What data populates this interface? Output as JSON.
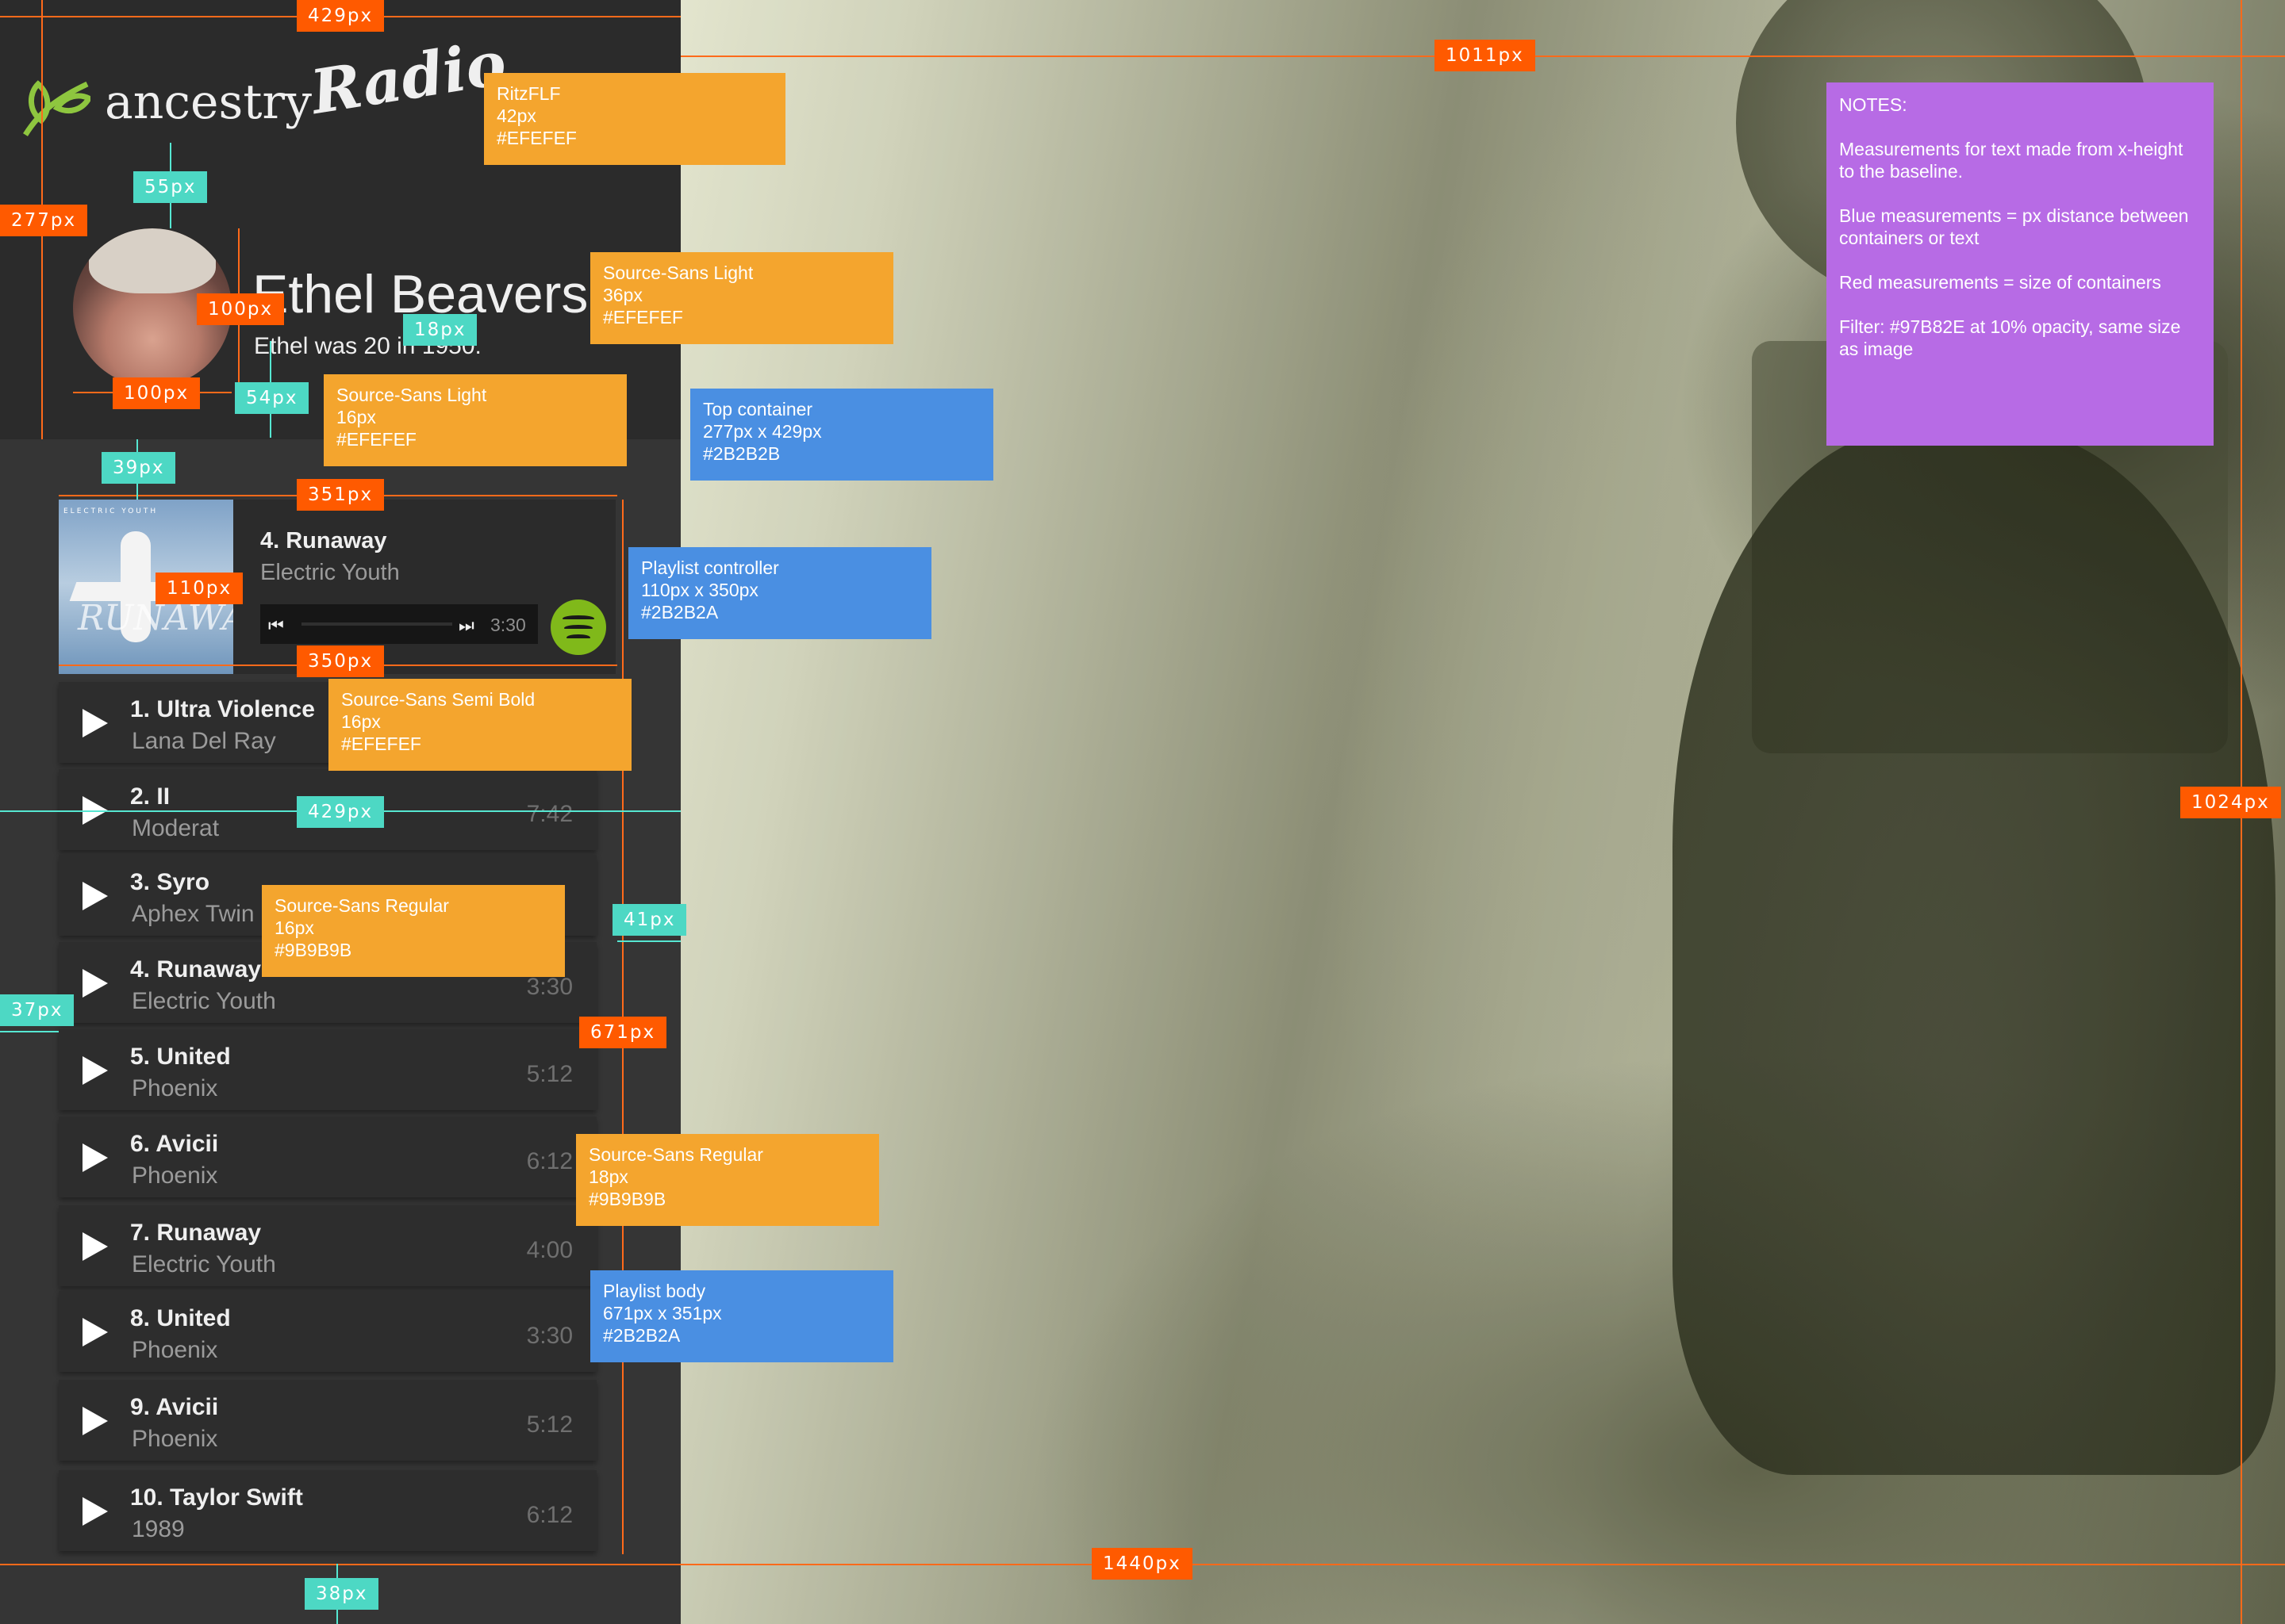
{
  "app": {
    "logo_text": "ancestry",
    "logo_radio": "Radio"
  },
  "profile": {
    "name": "Ethel Beavers",
    "subtitle": "Ethel was 20 in 1950."
  },
  "now_playing": {
    "title": "4. Runaway",
    "artist": "Electric Youth",
    "time": "3:30",
    "album_brand": "ELECTRIC YOUTH",
    "album_word": "RUNAWAY",
    "service": "spotify-icon"
  },
  "playlist": [
    {
      "title": "1. Ultra Violence",
      "artist": "Lana Del Ray",
      "duration": ""
    },
    {
      "title": "2. II",
      "artist": "Moderat",
      "duration": "7:42"
    },
    {
      "title": "3. Syro",
      "artist": "Aphex Twin",
      "duration": ""
    },
    {
      "title": "4. Runaway",
      "artist": "Electric Youth",
      "duration": "3:30"
    },
    {
      "title": "5. United",
      "artist": "Phoenix",
      "duration": "5:12"
    },
    {
      "title": "6. Avicii",
      "artist": "Phoenix",
      "duration": "6:12"
    },
    {
      "title": "7. Runaway",
      "artist": "Electric Youth",
      "duration": "4:00"
    },
    {
      "title": "8. United",
      "artist": "Phoenix",
      "duration": "3:30"
    },
    {
      "title": "9. Avicii",
      "artist": "Phoenix",
      "duration": "5:12"
    },
    {
      "title": "10. Taylor Swift",
      "artist": "1989",
      "duration": "6:12"
    }
  ],
  "measures": {
    "m429a": "429px",
    "m1011": "1011px",
    "m277": "277px",
    "m55": "55px",
    "m100a": "100px",
    "m18": "18px",
    "m100b": "100px",
    "m54": "54px",
    "m39": "39px",
    "m351": "351px",
    "m110": "110px",
    "m350": "350px",
    "m429b": "429px",
    "m41": "41px",
    "m37": "37px",
    "m671": "671px",
    "m1024": "1024px",
    "m1440": "1440px",
    "m38": "38px"
  },
  "annotations": {
    "a1": [
      "RitzFLF",
      "42px",
      "#EFEFEF"
    ],
    "a2": [
      "Source-Sans Light",
      "36px",
      "#EFEFEF"
    ],
    "a3": [
      "Source-Sans Light",
      "16px",
      "#EFEFEF"
    ],
    "a4": [
      "Top container",
      "277px x 429px",
      "#2B2B2B"
    ],
    "a5": [
      "Playlist controller",
      "110px x 350px",
      "#2B2B2A"
    ],
    "a6": [
      "Source-Sans Semi Bold",
      "16px",
      "#EFEFEF"
    ],
    "a7": [
      "Source-Sans Regular",
      "16px",
      "#9B9B9B"
    ],
    "a8": [
      "Source-Sans Regular",
      "18px",
      "#9B9B9B"
    ],
    "a9": [
      "Playlist body",
      "671px x 351px",
      "#2B2B2A"
    ]
  },
  "notes": [
    "NOTES:",
    "Measurements for text made from x-height to the baseline.",
    "Blue measurements = px distance between containers or text",
    "Red measurements = size of containers",
    "Filter: #97B82E at 10% opacity, same size as image"
  ],
  "colors": {
    "top_container": "#2B2B2B",
    "accent_text": "#EFEFEF",
    "muted_text": "#9B9B9B",
    "filter": "#97B82E"
  }
}
